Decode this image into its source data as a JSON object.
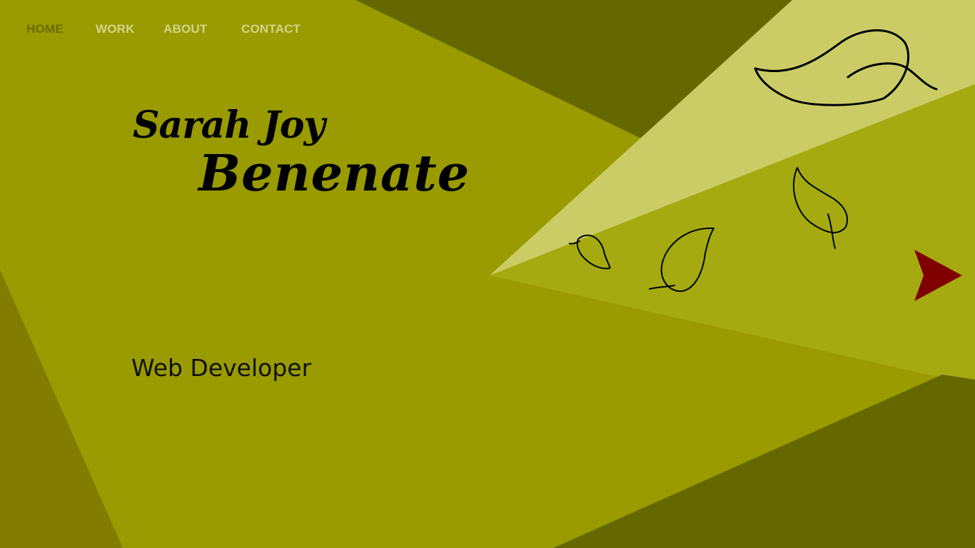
{
  "nav": {
    "items": [
      {
        "label": "HOME",
        "active": true
      },
      {
        "label": "WORK",
        "active": false
      },
      {
        "label": "ABOUT",
        "active": false
      },
      {
        "label": "CONTACT",
        "active": false
      }
    ]
  },
  "hero": {
    "first_name": "Sarah Joy",
    "last_name": "Benenate",
    "role": "Web Developer"
  },
  "icons": {
    "leaves": "leaf-icon",
    "next": "arrow-right-icon"
  },
  "colors": {
    "background": "#999b00",
    "dark_olive": "#676700",
    "light_beam": "#cccc66",
    "mid_beam": "#a5aa10",
    "left_shadow": "#827d00",
    "nav_active": "#6b6b00",
    "nav_inactive": "#d4d488",
    "accent_arrow": "#800000"
  }
}
